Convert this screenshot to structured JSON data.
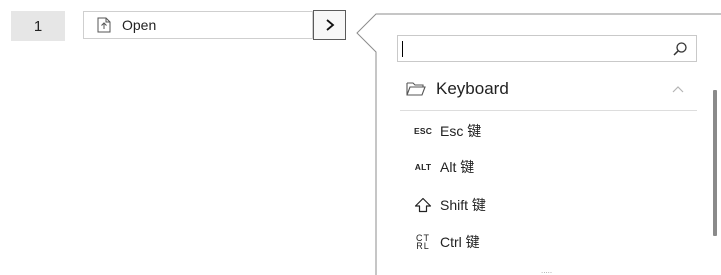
{
  "step": {
    "number": "1",
    "action_label": "Open",
    "expand_label": ">"
  },
  "popup": {
    "search": {
      "value": "",
      "placeholder": ""
    },
    "group": {
      "label": "Keyboard"
    },
    "items": [
      {
        "icon_text": "ESC",
        "label": "Esc 键",
        "icon": "esc-key-icon"
      },
      {
        "icon_text": "ALT",
        "label": "Alt 键",
        "icon": "alt-key-icon"
      },
      {
        "icon_text": "⇧",
        "label": "Shift 键",
        "icon": "shift-key-icon"
      },
      {
        "icon_text": "CTRL",
        "label": "Ctrl 键",
        "icon": "ctrl-key-icon"
      }
    ],
    "grip_text": "....."
  }
}
